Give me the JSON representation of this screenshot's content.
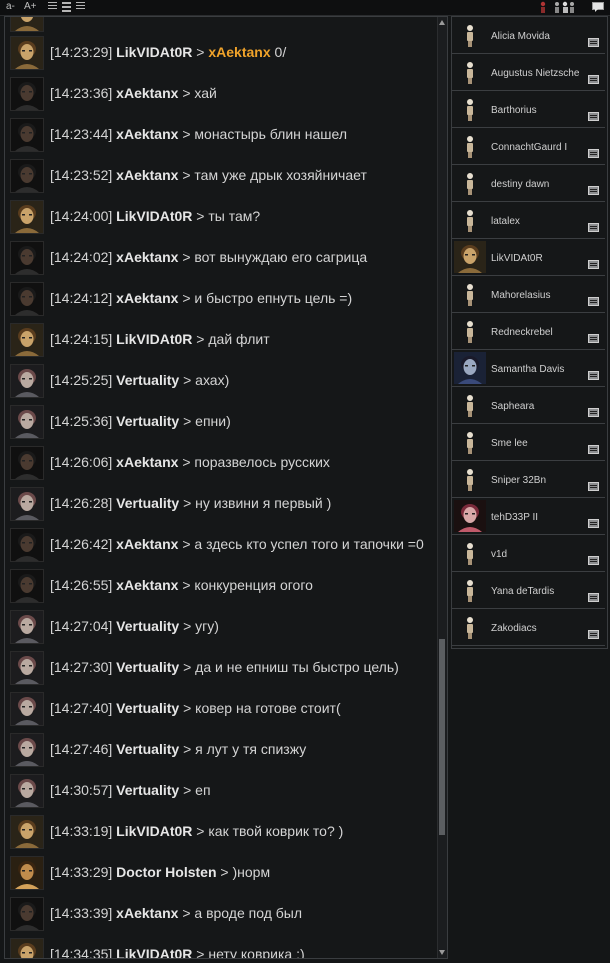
{
  "toolbar": {
    "font_smaller": "a-",
    "font_larger": "A+",
    "icons": [
      "compact-view-icon",
      "detailed-view-icon",
      "list-view-icon",
      "settings-icon",
      "members-icon",
      "chat-bubble-icon"
    ]
  },
  "chat": {
    "messages": [
      {
        "time": "[14:23:29]",
        "nick": "LikVIDAt0R",
        "sep": ">",
        "text_hl": "xAektanx",
        "text": " 0/",
        "avatar": "amarr"
      },
      {
        "time": "[14:23:36]",
        "nick": "xAektanx",
        "sep": ">",
        "text": "хай",
        "avatar": "dark"
      },
      {
        "time": "[14:23:44]",
        "nick": "xAektanx",
        "sep": ">",
        "text": "монастырь блин нашел",
        "avatar": "dark"
      },
      {
        "time": "[14:23:52]",
        "nick": "xAektanx",
        "sep": ">",
        "text": "там уже дрык хозяйничает",
        "avatar": "dark"
      },
      {
        "time": "[14:24:00]",
        "nick": "LikVIDAt0R",
        "sep": ">",
        "text": "ты там?",
        "avatar": "amarr"
      },
      {
        "time": "[14:24:02]",
        "nick": "xAektanx",
        "sep": ">",
        "text": "вот вынуждаю его сагрица",
        "avatar": "dark"
      },
      {
        "time": "[14:24:12]",
        "nick": "xAektanx",
        "sep": ">",
        "text": "и быстро епнуть цель =)",
        "avatar": "dark"
      },
      {
        "time": "[14:24:15]",
        "nick": "LikVIDAt0R",
        "sep": ">",
        "text": "дай флит",
        "avatar": "amarr"
      },
      {
        "time": "[14:25:25]",
        "nick": "Vertuality",
        "sep": ">",
        "text": "ахах)",
        "avatar": "pale"
      },
      {
        "time": "[14:25:36]",
        "nick": "Vertuality",
        "sep": ">",
        "text": "епни)",
        "avatar": "pale"
      },
      {
        "time": "[14:26:06]",
        "nick": "xAektanx",
        "sep": ">",
        "text": "поразвелось русских",
        "avatar": "dark"
      },
      {
        "time": "[14:26:28]",
        "nick": "Vertuality",
        "sep": ">",
        "text": "ну извини я первый )",
        "avatar": "pale"
      },
      {
        "time": "[14:26:42]",
        "nick": "xAektanx",
        "sep": ">",
        "text": "а здесь кто успел того и тапочки =0",
        "avatar": "dark"
      },
      {
        "time": "[14:26:55]",
        "nick": "xAektanx",
        "sep": ">",
        "text": "конкуренция огого",
        "avatar": "dark"
      },
      {
        "time": "[14:27:04]",
        "nick": "Vertuality",
        "sep": ">",
        "text": "угу)",
        "avatar": "pale"
      },
      {
        "time": "[14:27:30]",
        "nick": "Vertuality",
        "sep": ">",
        "text": "да и не епниш ты быстро цель)",
        "avatar": "pale"
      },
      {
        "time": "[14:27:40]",
        "nick": "Vertuality",
        "sep": ">",
        "text": "ковер на готове стоит(",
        "avatar": "pale"
      },
      {
        "time": "[14:27:46]",
        "nick": "Vertuality",
        "sep": ">",
        "text": "я лут у тя спизжу",
        "avatar": "pale"
      },
      {
        "time": "[14:30:57]",
        "nick": "Vertuality",
        "sep": ">",
        "text": "еп",
        "avatar": "pale"
      },
      {
        "time": "[14:33:19]",
        "nick": "LikVIDAt0R",
        "sep": ">",
        "text": "как твой коврик то? )",
        "avatar": "amarr"
      },
      {
        "time": "[14:33:29]",
        "nick": "Doctor Holsten",
        "sep": ">",
        "text": ")норм",
        "avatar": "gold"
      },
      {
        "time": "[14:33:39]",
        "nick": "xAektanx",
        "sep": ">",
        "text": "а вроде под был",
        "avatar": "dark"
      },
      {
        "time": "[14:34:35]",
        "nick": "LikVIDAt0R",
        "sep": ">",
        "text": "нету коврика :)",
        "avatar": "amarr"
      }
    ]
  },
  "members": [
    {
      "name": "Alicia Movida",
      "avatar": "silhouette"
    },
    {
      "name": "Augustus Nietzsche",
      "avatar": "silhouette"
    },
    {
      "name": "Barthorius",
      "avatar": "silhouette"
    },
    {
      "name": "ConnachtGaurd I",
      "avatar": "silhouette"
    },
    {
      "name": "destiny dawn",
      "avatar": "silhouette"
    },
    {
      "name": "latalex",
      "avatar": "silhouette"
    },
    {
      "name": "LikVIDAt0R",
      "avatar": "amarr"
    },
    {
      "name": "Mahorelasius",
      "avatar": "silhouette"
    },
    {
      "name": "Redneckrebel",
      "avatar": "silhouette"
    },
    {
      "name": "Samantha Davis",
      "avatar": "blue"
    },
    {
      "name": "Sapheara",
      "avatar": "silhouette"
    },
    {
      "name": "Sme lee",
      "avatar": "silhouette"
    },
    {
      "name": "Sniper 32Bn",
      "avatar": "silhouette"
    },
    {
      "name": "tehD33P II",
      "avatar": "pink"
    },
    {
      "name": "v1d",
      "avatar": "silhouette"
    },
    {
      "name": "Yana deTardis",
      "avatar": "silhouette"
    },
    {
      "name": "Zakodiacs",
      "avatar": "silhouette"
    }
  ],
  "colors": {
    "highlight": "#f0a32a",
    "background": "#141617",
    "text": "#d4d4d4"
  }
}
